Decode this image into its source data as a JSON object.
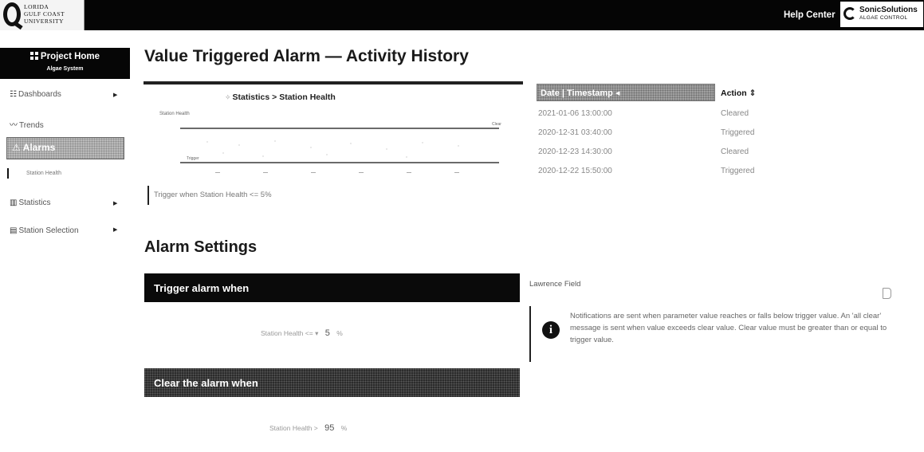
{
  "topbar": {
    "university_logo_lines": "LORIDA\nGULF COAST\nUNIVERSITY",
    "help_center": "Help Center",
    "brand_title": "SonicSolutions",
    "brand_subtitle": "ALGAE CONTROL"
  },
  "sidebar": {
    "project_title": "Project Home",
    "project_subtitle": "Algae System",
    "items": [
      {
        "label": "Dashboards",
        "icon": "grid-icon",
        "has_arrow": true
      },
      {
        "label": "Trends",
        "icon": "trend-icon",
        "has_arrow": false
      },
      {
        "label": "Alarms",
        "icon": "alarm-icon",
        "has_arrow": true,
        "active": true
      },
      {
        "label": "Statistics",
        "icon": "statistics-icon",
        "has_arrow": true
      },
      {
        "label": "Station Selection",
        "icon": "station-icon",
        "has_arrow": true
      }
    ],
    "sub_item": "Station Health"
  },
  "main": {
    "title": "Value Triggered Alarm — Activity History",
    "breadcrumb": "Statistics > Station Health",
    "trigger_description": "Trigger when Station Health <= 5%",
    "history": {
      "headers": {
        "timestamp": "Date | Timestamp ◂",
        "action": "Action ⇕"
      },
      "rows": [
        {
          "timestamp": "2021-01-06 13:00:00",
          "action": "Cleared"
        },
        {
          "timestamp": "2020-12-31 03:40:00",
          "action": "Triggered"
        },
        {
          "timestamp": "2020-12-23 14:30:00",
          "action": "Cleared"
        },
        {
          "timestamp": "2020-12-22 15:50:00",
          "action": "Triggered"
        }
      ]
    }
  },
  "chart_data": {
    "type": "line",
    "title": "",
    "ylabel": "Station Health",
    "annotations": [
      "Clear",
      "Trigger"
    ],
    "series": []
  },
  "settings": {
    "title": "Alarm Settings",
    "trigger_header": "Trigger alarm when",
    "trigger_param": "Station Health",
    "trigger_operator": "<=",
    "trigger_value": "5",
    "trigger_unit": "%",
    "clear_header": "Clear the alarm when",
    "clear_param": "Station Health >",
    "clear_value": "95",
    "clear_unit": "%",
    "station_name": "Lawrence Field",
    "notice": "Notifications are sent when parameter value reaches or falls below trigger value. An 'all clear' message is sent when value exceeds clear value. Clear value must be greater than or equal to trigger value."
  }
}
